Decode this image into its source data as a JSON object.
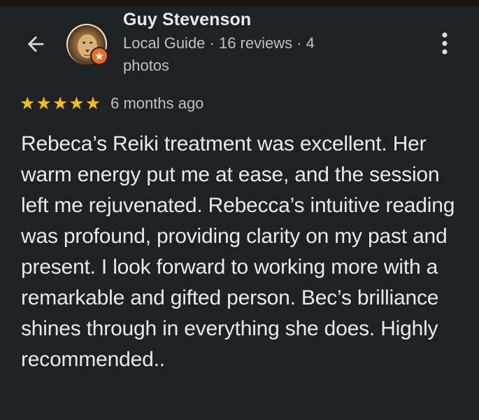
{
  "review": {
    "author_name": "Guy Stevenson",
    "author_meta": "Local Guide · 16 reviews · 4 photos",
    "rating": 5,
    "rating_max": 5,
    "time_ago": "6 months ago",
    "text": "Rebeca’s Reiki treatment was excellent. Her warm energy put me at ease, and the session left me rejuvenated. Rebecca’s intuitive reading was profound, providing clarity on my past and present. I look forward to working more with a remarkable and gifted person. Bec’s brilliance shines through in everything she does. Highly recommended.."
  },
  "icons": {
    "back": "arrow-back-icon",
    "more": "more-vert-icon",
    "badge": "local-guide-badge-icon",
    "star": "star-icon"
  },
  "colors": {
    "background": "#202124",
    "star": "#fbbc04",
    "badge": "#f06b22",
    "primary_text": "#e8eaed",
    "secondary_text": "#bdc1c6"
  }
}
